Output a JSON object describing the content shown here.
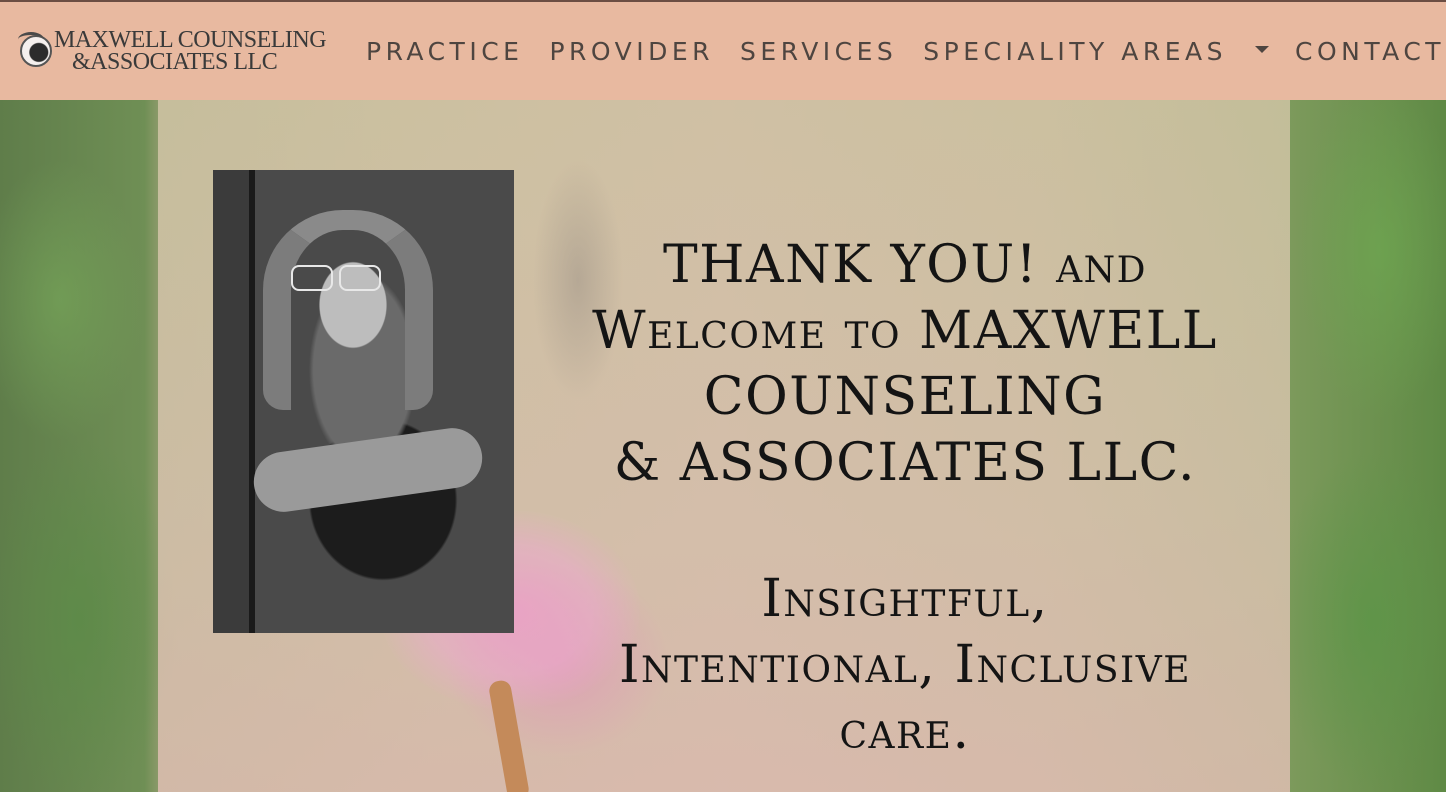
{
  "brand": {
    "line1": "MAXWELL COUNSELING",
    "line2": "&ASSOCIATES LLC",
    "icon": "logo-icon"
  },
  "nav": {
    "items": [
      {
        "label": "PRACTICE"
      },
      {
        "label": "PROVIDER"
      },
      {
        "label": "SERVICES"
      },
      {
        "label": "SPECIALITY AREAS",
        "dropdown": true
      },
      {
        "label": "CONTACT"
      }
    ]
  },
  "hero": {
    "headline_lines": [
      "THANK YOU! and",
      "Welcome to MAXWELL",
      "COUNSELING",
      "& ASSOCIATES LLC."
    ],
    "tagline_lines": [
      "Insightful,",
      "Intentional, Inclusive",
      "care."
    ]
  },
  "colors": {
    "nav_bg": "#e8b9a0",
    "nav_text": "#4e4540",
    "headline_text": "#141414"
  }
}
